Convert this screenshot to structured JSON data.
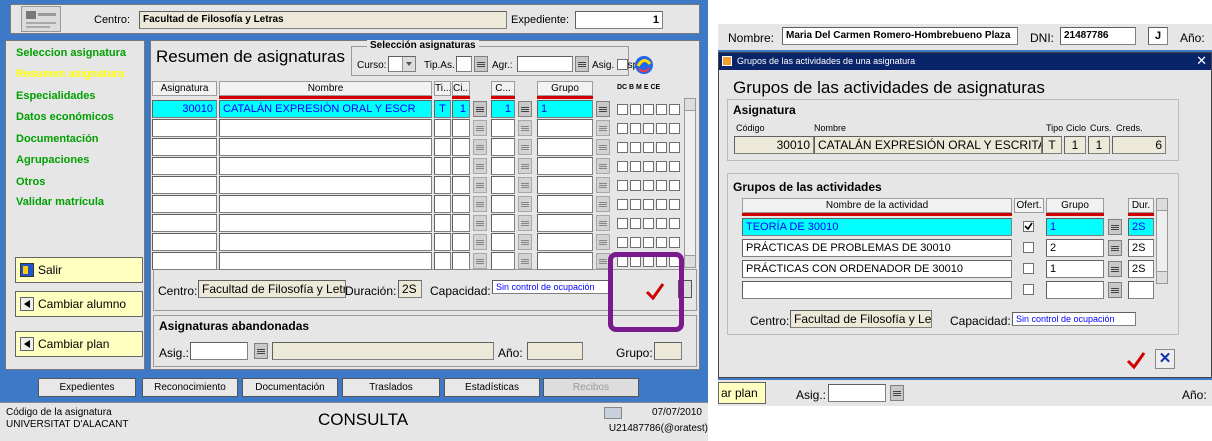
{
  "left_window": {
    "header": {
      "centro_label": "Centro:",
      "centro_value": "Facultad de Filosofía y Letras",
      "expediente_label": "Expediente:",
      "expediente_value": "1"
    },
    "sidebar": {
      "items": [
        {
          "label": "Seleccion asignatura",
          "active": false
        },
        {
          "label": "Resumen asignatura",
          "active": true
        },
        {
          "label": "Especialidades",
          "active": false
        },
        {
          "label": "Datos económicos",
          "active": false
        },
        {
          "label": "Documentación",
          "active": false
        },
        {
          "label": "Agrupaciones",
          "active": false
        },
        {
          "label": "Otros",
          "active": false
        },
        {
          "label": "Validar matrícula",
          "active": false
        }
      ],
      "salir_label": "Salir",
      "cambiar_alumno_label": "Cambiar alumno",
      "cambiar_plan_label": "Cambiar plan"
    },
    "main": {
      "title": "Resumen de asignaturas",
      "seleccion_title": "Selección asignaturas",
      "curso_label": "Curso:",
      "tipas_label": "Tip.As.",
      "agr_label": "Agr.:",
      "asig_susp_label": "Asig. susp.:",
      "table_headers": {
        "asignatura": "Asignatura",
        "nombre": "Nombre",
        "ti": "Ti...",
        "ci": "Ci...",
        "c": "C...",
        "grupo": "Grupo",
        "flags": "DC B M E CE"
      },
      "rows": [
        {
          "asignatura": "30010",
          "nombre": "CATALÁN EXPRESIÓN ORAL Y ESCR",
          "ti": "T",
          "ci": "1",
          "c": "1",
          "grupo": "1"
        }
      ],
      "centro_label": "Centro:",
      "centro_value": "Facultad de Filosofía y Letra",
      "duracion_label": "Duración:",
      "duracion_value": "2S",
      "capacidad_label": "Capacidad:",
      "capacidad_value": "Sin control de ocupación",
      "abandonadas_title": "Asignaturas abandonadas",
      "asig_label": "Asig.:",
      "ano_label": "Año:",
      "grupo_label": "Grupo:"
    },
    "bottom_tabs": [
      "Expedientes",
      "Reconocimiento",
      "Documentación",
      "Traslados",
      "Estadísticas",
      "Recibos"
    ],
    "status": {
      "field_label": "Código de la asignatura",
      "university": "UNIVERSITAT D'ALACANT",
      "mode": "CONSULTA",
      "date": "07/07/2010",
      "user": "U21487786(@oratest)"
    }
  },
  "right_window": {
    "behind": {
      "nombre_label": "Nombre:",
      "nombre_value": "Maria Del Carmen Romero-Hombrebueno Plaza",
      "dni_label": "DNI:",
      "dni_value": "21487786",
      "letter": "J",
      "ano_label": "Año:"
    },
    "dialog": {
      "titlebar": "Grupos de las actividades de una asignatura",
      "title": "Grupos de las actividades de asignaturas",
      "asignatura_section": "Asignatura",
      "headers": {
        "codigo": "Código",
        "nombre": "Nombre",
        "tipo": "Tipo",
        "ciclo": "Ciclo",
        "curs": "Curs.",
        "creds": "Creds."
      },
      "asignatura": {
        "codigo": "30010",
        "nombre": "CATALÁN EXPRESIÓN ORAL Y ESCRITA II",
        "tipo": "T",
        "ciclo": "1",
        "curs": "1",
        "creds": "6"
      },
      "grupos_section": "Grupos de las actividades",
      "table_headers": {
        "actividad": "Nombre de la actividad",
        "ofert": "Ofert.",
        "grupo": "Grupo",
        "dur": "Dur."
      },
      "activities": [
        {
          "name": "TEORÍA DE 30010",
          "ofert": true,
          "grupo": "1",
          "dur": "2S"
        },
        {
          "name": "PRÁCTICAS DE PROBLEMAS DE 30010",
          "ofert": false,
          "grupo": "2",
          "dur": "2S"
        },
        {
          "name": "PRÁCTICAS CON ORDENADOR DE 30010",
          "ofert": false,
          "grupo": "1",
          "dur": "2S"
        }
      ],
      "centro_label": "Centro:",
      "centro_value": "Facultad de Filosofía y Letra",
      "capacidad_label": "Capacidad:",
      "capacidad_value": "Sin control de ocupación"
    },
    "below": {
      "plan_label": "ar plan",
      "asig_label": "Asig.:",
      "ano_label": "Año:"
    }
  },
  "colors": {
    "app_bg": "#3d79c6",
    "form_bg": "#e6e6e6",
    "highlight": "#00ffff",
    "annotation": "#7b1a8c",
    "link_green": "#00a000",
    "link_active": "#ffff00"
  }
}
